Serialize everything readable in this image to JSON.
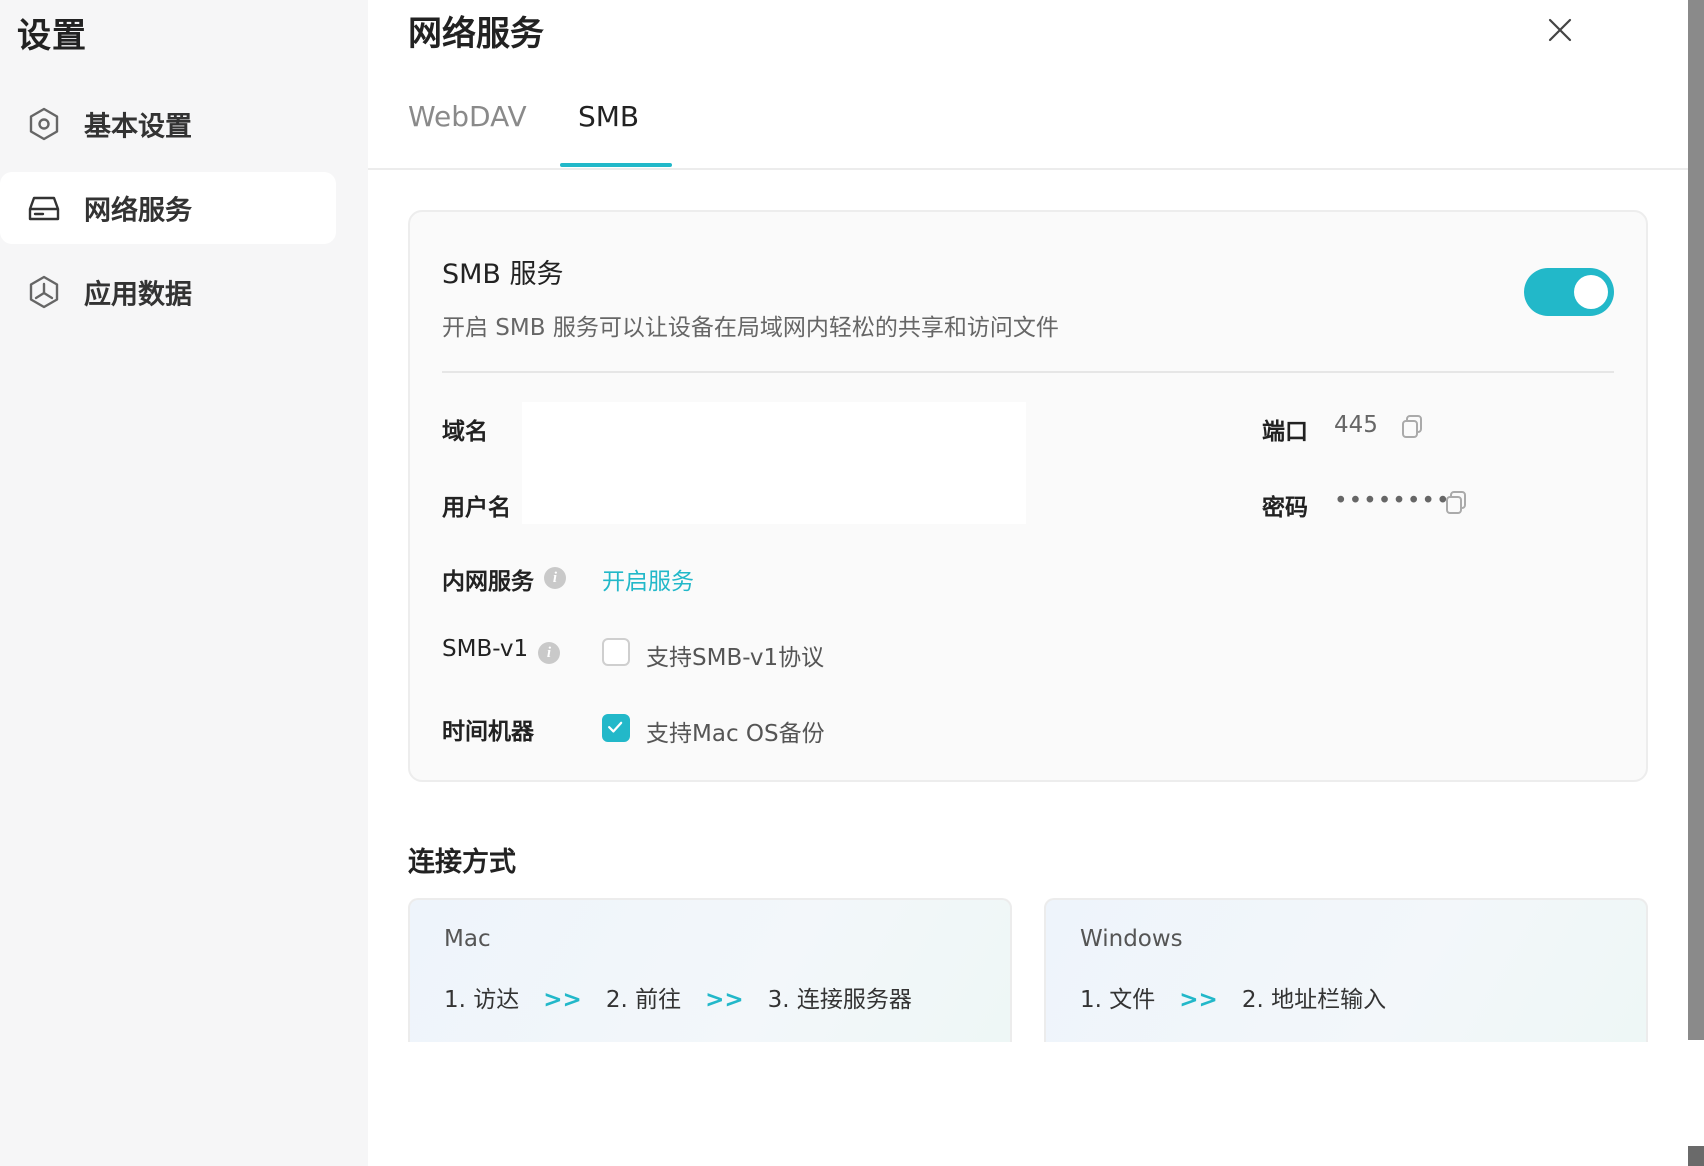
{
  "sidebar": {
    "title": "设置",
    "items": [
      {
        "label": "基本设置",
        "icon": "hexagon-gear-icon"
      },
      {
        "label": "网络服务",
        "icon": "drive-icon"
      },
      {
        "label": "应用数据",
        "icon": "hexagon-app-icon"
      }
    ],
    "active_index": 1
  },
  "main": {
    "title": "网络服务",
    "tabs": [
      {
        "label": "WebDAV"
      },
      {
        "label": "SMB"
      }
    ],
    "active_tab": 1
  },
  "smb_card": {
    "title": "SMB 服务",
    "description": "开启 SMB 服务可以让设备在局域网内轻松的共享和访问文件",
    "enabled": true,
    "fields": {
      "domain_label": "域名",
      "username_label": "用户名",
      "port_label": "端口",
      "port_value": "445",
      "password_label": "密码",
      "password_value": "••••••••",
      "intranet_label": "内网服务",
      "intranet_link": "开启服务",
      "smbv1_label": "SMB-v1",
      "smbv1_option": "支持SMB-v1协议",
      "smbv1_checked": false,
      "timemachine_label": "时间机器",
      "timemachine_option": "支持Mac OS备份",
      "timemachine_checked": true
    }
  },
  "connection": {
    "title": "连接方式",
    "arrow": ">>",
    "mac": {
      "os": "Mac",
      "steps": [
        "1. 访达",
        "2. 前往",
        "3. 连接服务器"
      ]
    },
    "windows": {
      "os": "Windows",
      "steps": [
        "1. 文件",
        "2. 地址栏输入"
      ]
    }
  },
  "colors": {
    "accent": "#22b8c9",
    "sidebar_bg": "#f6f6f7",
    "card_bg": "#fafafa"
  }
}
